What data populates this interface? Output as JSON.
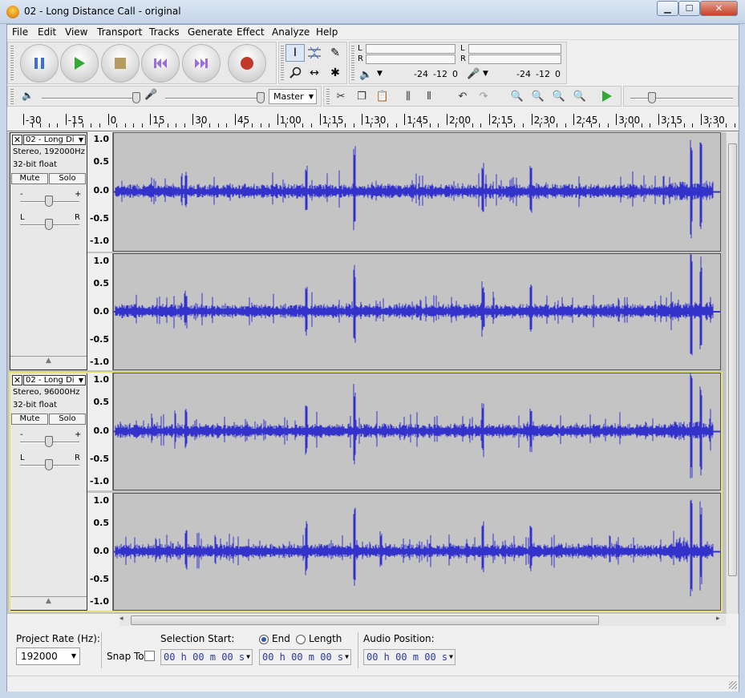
{
  "window": {
    "title": "02 - Long Distance Call - original",
    "minimize": "▁",
    "maximize": "☐",
    "close": "✕"
  },
  "menu": [
    "File",
    "Edit",
    "View",
    "Transport",
    "Tracks",
    "Generate",
    "Effect",
    "Analyze",
    "Help"
  ],
  "meters": {
    "playback_ticks": [
      "-24",
      "-12",
      "0"
    ],
    "record_ticks": [
      "-24",
      "-12",
      "0"
    ],
    "channel_l": "L",
    "channel_r": "R"
  },
  "mixer": {
    "output_device": "Master"
  },
  "ruler": {
    "labels": [
      "-30",
      "-15",
      "0",
      "15",
      "30",
      "45",
      "1:00",
      "1:15",
      "1:30",
      "1:45",
      "2:00",
      "2:15",
      "2:30",
      "2:45",
      "3:00",
      "3:15",
      "3:30"
    ]
  },
  "tracks": [
    {
      "name": "02 - Long Di",
      "format": "Stereo, 192000Hz",
      "bitdepth": "32-bit float",
      "mute": "Mute",
      "solo": "Solo",
      "gain_minus": "-",
      "gain_plus": "+",
      "pan_left": "L",
      "pan_right": "R",
      "scale": [
        "1.0",
        "0.5",
        "0.0",
        "-0.5",
        "-1.0"
      ]
    },
    {
      "name": "02 - Long Di",
      "format": "Stereo, 96000Hz",
      "bitdepth": "32-bit float",
      "mute": "Mute",
      "solo": "Solo",
      "gain_minus": "-",
      "gain_plus": "+",
      "pan_left": "L",
      "pan_right": "R",
      "scale": [
        "1.0",
        "0.5",
        "0.0",
        "-0.5",
        "-1.0"
      ]
    }
  ],
  "bottom": {
    "project_rate_label": "Project Rate (Hz):",
    "project_rate_value": "192000",
    "snap_to_label": "Snap To",
    "selection_start_label": "Selection Start:",
    "end_label": "End",
    "length_label": "Length",
    "audio_position_label": "Audio Position:",
    "time_value": "00 h 00 m 00 s"
  },
  "colors": {
    "waveform": "#3333cc",
    "wave_bg": "#c4c4c4",
    "selected_track": "#e8e07a",
    "play_green": "#33aa33",
    "record_red": "#c0392b",
    "pause_blue": "#3a6fd8"
  }
}
